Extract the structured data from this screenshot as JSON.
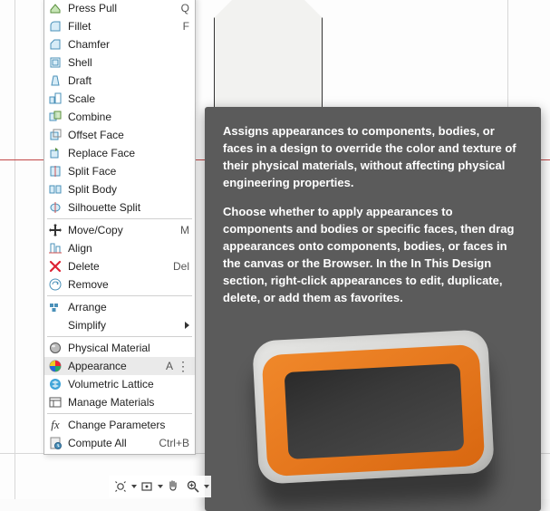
{
  "menu": {
    "sections": [
      [
        {
          "id": "press-pull",
          "label": "Press Pull",
          "shortcut": "Q",
          "icon": "presspull"
        },
        {
          "id": "fillet",
          "label": "Fillet",
          "shortcut": "F",
          "icon": "fillet"
        },
        {
          "id": "chamfer",
          "label": "Chamfer",
          "icon": "chamfer"
        },
        {
          "id": "shell",
          "label": "Shell",
          "icon": "shell"
        },
        {
          "id": "draft",
          "label": "Draft",
          "icon": "draft"
        },
        {
          "id": "scale",
          "label": "Scale",
          "icon": "scale"
        },
        {
          "id": "combine",
          "label": "Combine",
          "icon": "combine"
        },
        {
          "id": "offset-face",
          "label": "Offset Face",
          "icon": "offsetface"
        },
        {
          "id": "replace-face",
          "label": "Replace Face",
          "icon": "replaceface"
        },
        {
          "id": "split-face",
          "label": "Split Face",
          "icon": "splitface"
        },
        {
          "id": "split-body",
          "label": "Split Body",
          "icon": "splitbody"
        },
        {
          "id": "silhouette-split",
          "label": "Silhouette Split",
          "icon": "silhouette"
        }
      ],
      [
        {
          "id": "move-copy",
          "label": "Move/Copy",
          "shortcut": "M",
          "icon": "move"
        },
        {
          "id": "align",
          "label": "Align",
          "icon": "align"
        },
        {
          "id": "delete",
          "label": "Delete",
          "shortcut": "Del",
          "icon": "delete"
        },
        {
          "id": "remove",
          "label": "Remove",
          "icon": "remove"
        }
      ],
      [
        {
          "id": "arrange",
          "label": "Arrange",
          "icon": "arrange"
        },
        {
          "id": "simplify",
          "label": "Simplify",
          "submenu": true
        }
      ],
      [
        {
          "id": "physical-material",
          "label": "Physical Material",
          "icon": "physmat"
        },
        {
          "id": "appearance",
          "label": "Appearance",
          "shortcut": "A",
          "icon": "appearance",
          "highlighted": true,
          "more": true
        },
        {
          "id": "volumetric-lattice",
          "label": "Volumetric Lattice",
          "icon": "lattice"
        },
        {
          "id": "manage-materials",
          "label": "Manage Materials",
          "icon": "managemat"
        }
      ],
      [
        {
          "id": "change-parameters",
          "label": "Change Parameters",
          "icon": "fx"
        },
        {
          "id": "compute-all",
          "label": "Compute All",
          "shortcut": "Ctrl+B",
          "icon": "compute"
        }
      ]
    ]
  },
  "tooltip": {
    "para1": "Assigns appearances to components, bodies, or faces in a design to override the color and texture of their physical materials, without affecting physical engineering properties.",
    "para2": "Choose whether to apply appearances to components and bodies or specific faces, then drag appearances onto components, bodies, or faces in the canvas or the Browser. In the In This Design section, right-click appearances to edit, duplicate, delete, or add them as favorites."
  },
  "colors": {
    "tooltip_bg": "#5b5b5b",
    "bezel_orange": "#e6781e",
    "axis_red": "#c24848"
  },
  "view_toolbar": {
    "items": [
      {
        "id": "orbit",
        "name": "orbit-icon"
      },
      {
        "id": "look-at",
        "name": "look-at-icon"
      },
      {
        "id": "pan",
        "name": "pan-icon"
      },
      {
        "id": "zoom",
        "name": "zoom-icon"
      }
    ]
  }
}
